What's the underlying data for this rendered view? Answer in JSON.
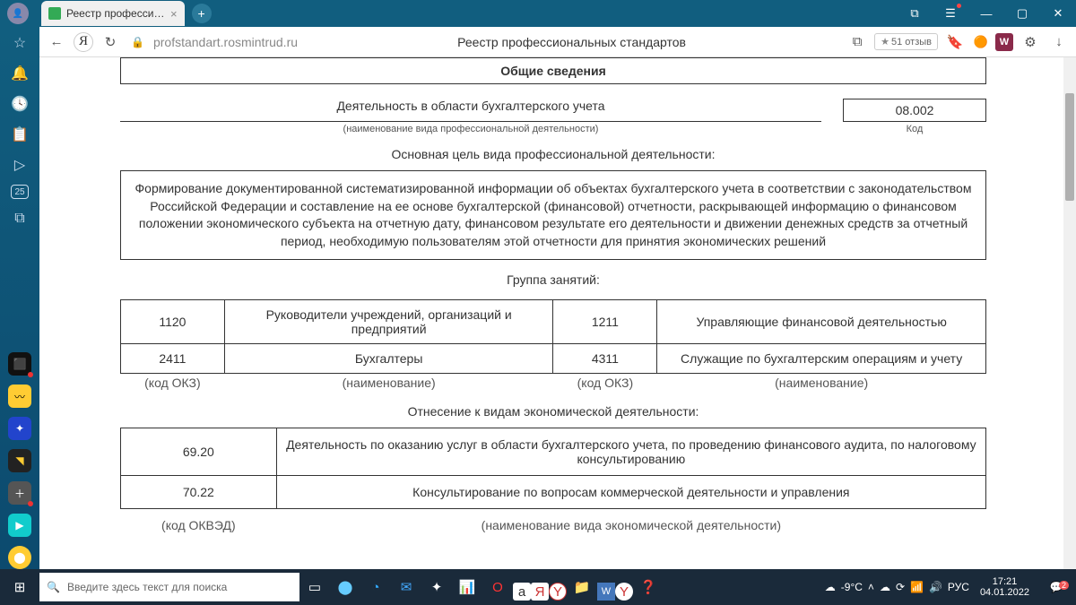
{
  "titlebar": {
    "tab_title": "Реестр профессиональ",
    "close": "×",
    "plus": "+"
  },
  "urlbar": {
    "back": "←",
    "ya": "Я",
    "reload": "↻",
    "lock": "🔒",
    "url": "profstandart.rosmintrud.ru",
    "page_title": "Реестр профессиональных стандартов",
    "reviews_star": "★",
    "reviews": "51 отзыв",
    "bookmark": "🔖",
    "ext_w": "W",
    "dl": "↓"
  },
  "sidebar": {
    "icons": [
      "☆",
      "🔔",
      "🕓",
      "📋",
      "▷",
      "25",
      "⧉"
    ],
    "apps": [
      "⬛",
      "〰",
      "✦",
      "◥",
      "＋",
      "▶",
      "⬤"
    ]
  },
  "doc": {
    "general_header": "Общие сведения",
    "activity_name": "Деятельность в области бухгалтерского учета",
    "code": "08.002",
    "activity_hint": "(наименование вида профессиональной деятельности)",
    "code_hint": "Код",
    "goal_title": "Основная цель вида профессиональной деятельности:",
    "goal_text": "Формирование документированной систематизированной информации об объектах бухгалтерского учета в соответствии с законодательством Российской Федерации и составление на ее основе бухгалтерской (финансовой) отчетности, раскрывающей информацию о финансовом положении экономического субъекта на отчетную дату, финансовом результате его деятельности и движении денежных средств за отчетный период, необходимую пользователям этой отчетности для принятия экономических решений",
    "group_title": "Группа занятий:",
    "group_rows": [
      {
        "c1": "1120",
        "n1": "Руководители учреждений, организаций и предприятий",
        "c2": "1211",
        "n2": "Управляющие финансовой деятельностью"
      },
      {
        "c1": "2411",
        "n1": "Бухгалтеры",
        "c2": "4311",
        "n2": "Служащие по бухгалтерским операциям и учету"
      }
    ],
    "group_hints": {
      "c": "(код ОКЗ)",
      "n": "(наименование)"
    },
    "econ_title": "Отнесение к видам экономической деятельности:",
    "econ_rows": [
      {
        "code": "69.20",
        "name": "Деятельность по оказанию услуг в области бухгалтерского учета, по проведению финансового аудита, по налоговому консультированию"
      },
      {
        "code": "70.22",
        "name": "Консультирование по вопросам коммерческой деятельности и управления"
      }
    ],
    "econ_hints": {
      "code": "(код ОКВЭД)",
      "name": "(наименование вида экономической деятельности)"
    }
  },
  "taskbar": {
    "search_placeholder": "Введите здесь текст для поиска",
    "weather": "-9°C",
    "lang": "РУС",
    "time": "17:21",
    "date": "04.01.2022",
    "notif_count": "2"
  }
}
